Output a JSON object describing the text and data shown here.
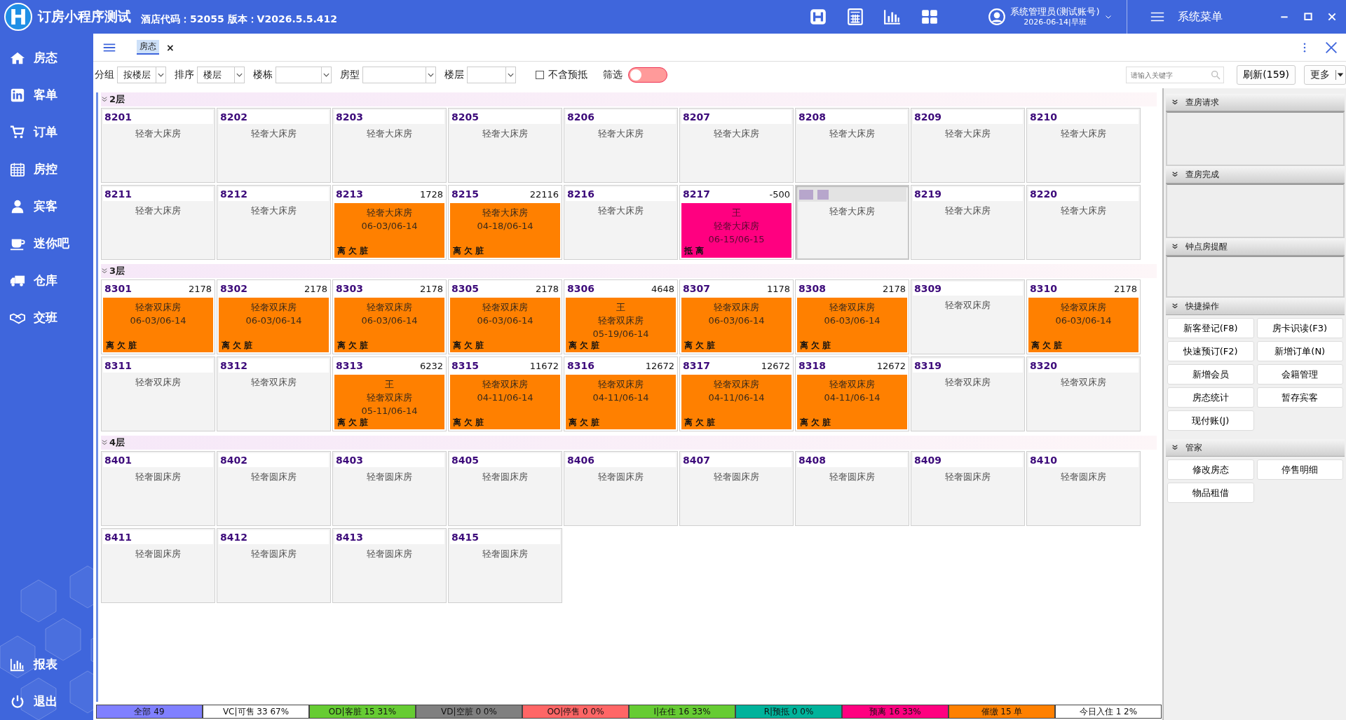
{
  "app": {
    "logo": "H",
    "title": "订房小程序测试",
    "hotel_info": "酒店代码：52055 版本：V2026.5.5.412"
  },
  "top_icons": [
    {
      "kind": "h-square"
    },
    {
      "kind": "calculator"
    },
    {
      "kind": "chart"
    },
    {
      "kind": "grid"
    }
  ],
  "user": {
    "name": "系统管理员(测试账号)",
    "shift": "2026-06-14|早班"
  },
  "system_menu": "系统菜单",
  "sidebar": {
    "items": [
      {
        "label": "房态",
        "kind": "home"
      },
      {
        "label": "客单",
        "kind": "card"
      },
      {
        "label": "订单",
        "kind": "cart"
      },
      {
        "label": "房控",
        "kind": "calendar"
      },
      {
        "label": "宾客",
        "kind": "person"
      },
      {
        "label": "迷你吧",
        "kind": "cup"
      },
      {
        "label": "仓库",
        "kind": "truck"
      },
      {
        "label": "交班",
        "kind": "handshake"
      }
    ],
    "bottom_items": [
      {
        "label": "报表",
        "kind": "chart"
      },
      {
        "label": "退出",
        "kind": "power"
      }
    ]
  },
  "tabs": [
    {
      "label": "房态",
      "selected": true,
      "close": "×"
    }
  ],
  "toolbar": {
    "filters": [
      {
        "label": "分组",
        "value": "按楼层"
      },
      {
        "label": "排序",
        "value": "楼层"
      },
      {
        "label": "楼栋"
      },
      {
        "label": "房型"
      },
      {
        "label": "楼层"
      }
    ],
    "exclude_checkbox": {
      "label": "不含预抵",
      "checked": false
    },
    "filter_toggle": {
      "label": "筛选",
      "on": false
    },
    "search": {
      "placeholder": "请输入关键字"
    },
    "refresh": "刷新(159)",
    "more": "更多"
  },
  "floors": [
    {
      "name": "2层",
      "expanded": true,
      "rooms": [
        {
          "number": "8201",
          "type": "轻奢大床房",
          "kind": "vacant"
        },
        {
          "number": "8202",
          "type": "轻奢大床房",
          "kind": "vacant"
        },
        {
          "number": "8203",
          "type": "轻奢大床房",
          "kind": "vacant"
        },
        {
          "number": "8205",
          "type": "轻奢大床房",
          "kind": "vacant"
        },
        {
          "number": "8206",
          "type": "轻奢大床房",
          "kind": "vacant"
        },
        {
          "number": "8207",
          "type": "轻奢大床房",
          "kind": "vacant"
        },
        {
          "number": "8208",
          "type": "轻奢大床房",
          "kind": "vacant"
        },
        {
          "number": "8209",
          "type": "轻奢大床房",
          "kind": "vacant"
        },
        {
          "number": "8210",
          "type": "轻奢大床房",
          "kind": "vacant"
        },
        {
          "number": "8211",
          "type": "轻奢大床房",
          "kind": "vacant"
        },
        {
          "number": "8212",
          "type": "轻奢大床房",
          "kind": "vacant"
        },
        {
          "number": "8213",
          "amount": "1728",
          "type": "轻奢大床房",
          "dates": "06-03/06-14",
          "tags": "离 欠 脏",
          "kind": "occupied"
        },
        {
          "number": "8215",
          "amount": "22116",
          "type": "轻奢大床房",
          "dates": "04-18/06-14",
          "tags": "离 欠 脏",
          "kind": "occupied"
        },
        {
          "number": "8216",
          "type": "轻奢大床房",
          "kind": "vacant"
        },
        {
          "number": "8217",
          "amount": "-500",
          "guest": "王",
          "type": "轻奢大床房",
          "dates": "06-15/06-15",
          "tags": "抵 离",
          "kind": "due_out"
        },
        {
          "number_hidden": true,
          "type": "轻奢大床房",
          "kind": "vacant",
          "selected": true
        },
        {
          "number": "8219",
          "type": "轻奢大床房",
          "kind": "vacant"
        },
        {
          "number": "8220",
          "type": "轻奢大床房",
          "kind": "vacant"
        }
      ]
    },
    {
      "name": "3层",
      "expanded": true,
      "rooms": [
        {
          "number": "8301",
          "amount": "2178",
          "type": "轻奢双床房",
          "dates": "06-03/06-14",
          "tags": "离 欠 脏",
          "kind": "occupied"
        },
        {
          "number": "8302",
          "amount": "2178",
          "type": "轻奢双床房",
          "dates": "06-03/06-14",
          "tags": "离 欠 脏",
          "kind": "occupied"
        },
        {
          "number": "8303",
          "amount": "2178",
          "type": "轻奢双床房",
          "dates": "06-03/06-14",
          "tags": "离 欠 脏",
          "kind": "occupied"
        },
        {
          "number": "8305",
          "amount": "2178",
          "type": "轻奢双床房",
          "dates": "06-03/06-14",
          "tags": "离 欠 脏",
          "kind": "occupied"
        },
        {
          "number": "8306",
          "amount": "4648",
          "guest": "王",
          "type": "轻奢双床房",
          "dates": "05-19/06-14",
          "tags": "离 欠 脏",
          "kind": "occupied"
        },
        {
          "number": "8307",
          "amount": "1178",
          "type": "轻奢双床房",
          "dates": "06-03/06-14",
          "tags": "离 欠 脏",
          "kind": "occupied"
        },
        {
          "number": "8308",
          "amount": "2178",
          "type": "轻奢双床房",
          "dates": "06-03/06-14",
          "tags": "离 欠 脏",
          "kind": "occupied"
        },
        {
          "number": "8309",
          "type": "轻奢双床房",
          "kind": "vacant"
        },
        {
          "number": "8310",
          "amount": "2178",
          "type": "轻奢双床房",
          "dates": "06-03/06-14",
          "tags": "离 欠 脏",
          "kind": "occupied"
        },
        {
          "number": "8311",
          "type": "轻奢双床房",
          "kind": "vacant"
        },
        {
          "number": "8312",
          "type": "轻奢双床房",
          "kind": "vacant"
        },
        {
          "number": "8313",
          "amount": "6232",
          "guest": "王",
          "type": "轻奢双床房",
          "dates": "05-11/06-14",
          "tags": "离 欠 脏",
          "kind": "occupied"
        },
        {
          "number": "8315",
          "amount": "11672",
          "type": "轻奢双床房",
          "dates": "04-11/06-14",
          "tags": "离 欠 脏",
          "kind": "occupied"
        },
        {
          "number": "8316",
          "amount": "12672",
          "type": "轻奢双床房",
          "dates": "04-11/06-14",
          "tags": "离 欠 脏",
          "kind": "occupied"
        },
        {
          "number": "8317",
          "amount": "12672",
          "type": "轻奢双床房",
          "dates": "04-11/06-14",
          "tags": "离 欠 脏",
          "kind": "occupied"
        },
        {
          "number": "8318",
          "amount": "12672",
          "type": "轻奢双床房",
          "dates": "04-11/06-14",
          "tags": "离 欠 脏",
          "kind": "occupied"
        },
        {
          "number": "8319",
          "type": "轻奢双床房",
          "kind": "vacant"
        },
        {
          "number": "8320",
          "type": "轻奢双床房",
          "kind": "vacant"
        }
      ]
    },
    {
      "name": "4层",
      "expanded": true,
      "rooms": [
        {
          "number": "8401",
          "type": "轻奢圆床房",
          "kind": "vacant"
        },
        {
          "number": "8402",
          "type": "轻奢圆床房",
          "kind": "vacant"
        },
        {
          "number": "8403",
          "type": "轻奢圆床房",
          "kind": "vacant"
        },
        {
          "number": "8405",
          "type": "轻奢圆床房",
          "kind": "vacant"
        },
        {
          "number": "8406",
          "type": "轻奢圆床房",
          "kind": "vacant"
        },
        {
          "number": "8407",
          "type": "轻奢圆床房",
          "kind": "vacant"
        },
        {
          "number": "8408",
          "type": "轻奢圆床房",
          "kind": "vacant"
        },
        {
          "number": "8409",
          "type": "轻奢圆床房",
          "kind": "vacant"
        },
        {
          "number": "8410",
          "type": "轻奢圆床房",
          "kind": "vacant"
        },
        {
          "number": "8411",
          "type": "轻奢圆床房",
          "kind": "vacant"
        },
        {
          "number": "8412",
          "type": "轻奢圆床房",
          "kind": "vacant"
        },
        {
          "number": "8413",
          "type": "轻奢圆床房",
          "kind": "vacant"
        },
        {
          "number": "8415",
          "type": "轻奢圆床房",
          "kind": "vacant"
        }
      ]
    }
  ],
  "right_panel": {
    "sections": [
      {
        "title": "查房请求",
        "kind": "list"
      },
      {
        "title": "查房完成",
        "kind": "list"
      },
      {
        "title": "钟点房提醒",
        "kind": "list"
      },
      {
        "title": "快捷操作",
        "kind": "buttons",
        "buttons": [
          "新客登记(F8)",
          "房卡识读(F3)",
          "快速预订(F2)",
          "新增订单(N)",
          "新增会员",
          "会籍管理",
          "房态统计",
          "暂存宾客",
          "现付账(J)"
        ]
      },
      {
        "title": "管家",
        "kind": "buttons",
        "buttons": [
          "修改房态",
          "停售明细",
          "物品租借"
        ]
      }
    ]
  },
  "status_bar": [
    {
      "label": "全部 49",
      "color": "#8080ff"
    },
    {
      "label": "VC|可售 33 67%",
      "color": "#ffffff"
    },
    {
      "label": "OD|客脏 15 31%",
      "color": "#66cc33"
    },
    {
      "label": "VD|空脏 0 0%",
      "color": "#808080"
    },
    {
      "label": "OO|停售 0 0%",
      "color": "#ff6666"
    },
    {
      "label": "I|在住 16 33%",
      "color": "#66cc33"
    },
    {
      "label": "R|预抵 0 0%",
      "color": "#00b39b"
    },
    {
      "label": "预离 16 33%",
      "color": "#ff0080"
    },
    {
      "label": "催缴 15 单",
      "color": "#ff8000"
    },
    {
      "label": "今日入住 1 2%",
      "color": "#ffffff"
    }
  ]
}
